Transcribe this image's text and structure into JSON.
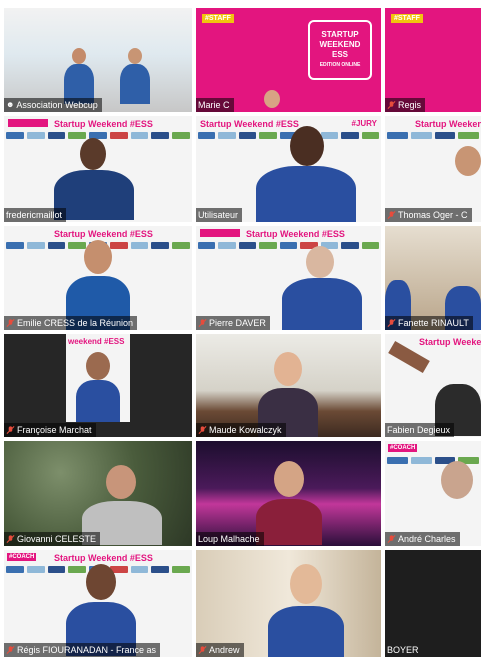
{
  "meeting": {
    "participants": [
      {
        "name": "Association Webcup"
      },
      {
        "name": "Marie C"
      },
      {
        "name": "Regis"
      },
      {
        "name": "fredericmaillot"
      },
      {
        "name": "Utilisateur"
      },
      {
        "name": "Thomas Oger - C"
      },
      {
        "name": "Emilie CRESS de la Réunion"
      },
      {
        "name": "Pierre DAVER"
      },
      {
        "name": "Fanette RINAULT"
      },
      {
        "name": "Françoise Marchat"
      },
      {
        "name": "Maude Kowalczyk"
      },
      {
        "name": "Fabien Degieux"
      },
      {
        "name": "Giovanni CELESTE"
      },
      {
        "name": "Loup Malhache"
      },
      {
        "name": "André Charles"
      },
      {
        "name": "Régis FIOURANADAN - France as"
      },
      {
        "name": "Andrew"
      },
      {
        "name": "BOYER"
      }
    ],
    "backgrounds": {
      "staff_tag": "#STAFF",
      "coach_tag": "#COACH",
      "startup_weekend": "Startup Weekend #ESS",
      "jury_tag": "#JURY",
      "startup_logo_line1": "STARTUP",
      "startup_logo_line2": "WEEKEND",
      "startup_logo_line3": "ESS",
      "startup_logo_line4": "EDITION ONLINE"
    },
    "colors": {
      "brand_pink": "#e3157f",
      "speaker_outline": "#c6e34b",
      "mic_muted": "#e74c3c"
    }
  }
}
